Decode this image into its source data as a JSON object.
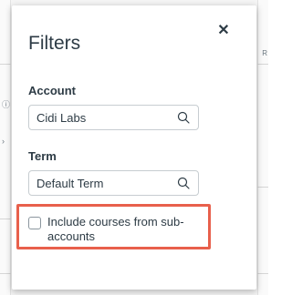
{
  "tray": {
    "title": "Filters",
    "close_icon": "close-icon"
  },
  "account": {
    "label": "Account",
    "value": "Cidi Labs",
    "icon": "search-icon"
  },
  "term": {
    "label": "Term",
    "value": "Default Term",
    "icon": "search-icon"
  },
  "subaccounts": {
    "label": "Include courses from sub-accounts",
    "checked": false
  },
  "background": {
    "right_edge_text": "R"
  },
  "colors": {
    "highlight": "#e8604c",
    "text": "#2d3b45",
    "border": "#c7cdd1"
  }
}
